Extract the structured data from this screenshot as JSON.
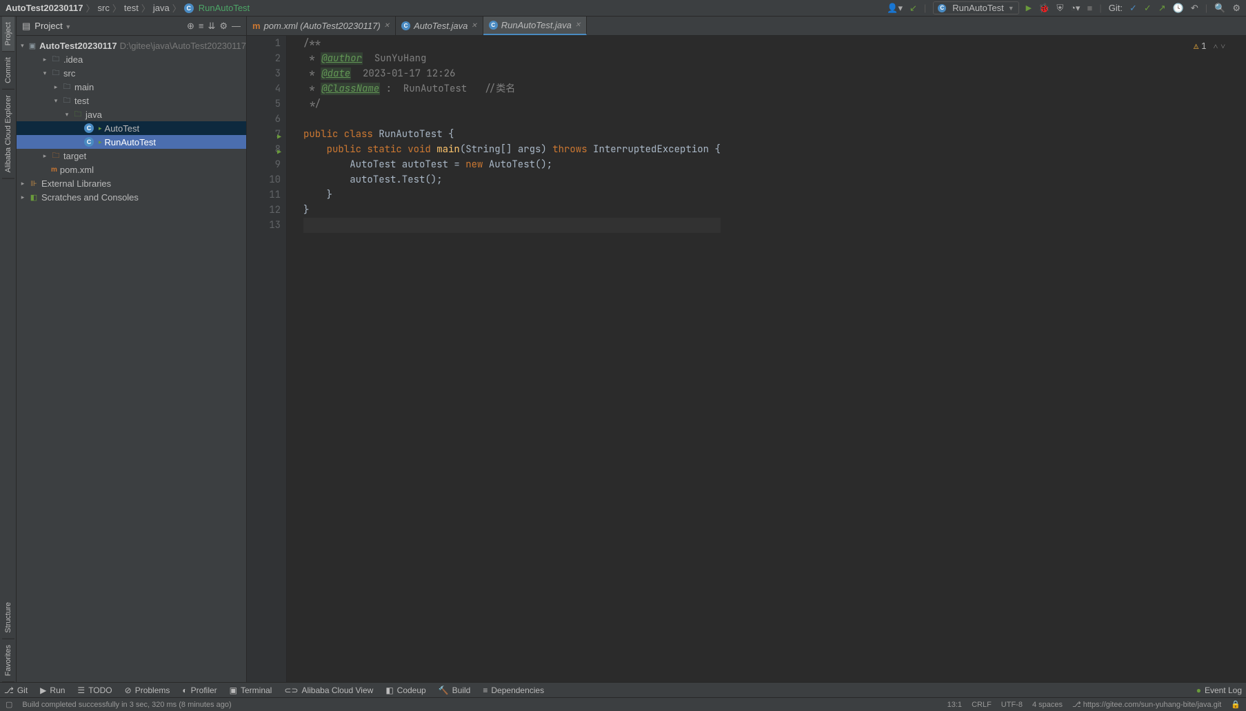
{
  "breadcrumb": [
    "AutoTest20230117",
    "src",
    "test",
    "java",
    "RunAutoTest"
  ],
  "run_config": "RunAutoTest",
  "git_label": "Git:",
  "project": {
    "panel_title": "Project",
    "root": {
      "name": "AutoTest20230117",
      "path": "D:\\gitee\\java\\AutoTest20230117"
    },
    "tree": [
      {
        "name": ".idea",
        "type": "folder",
        "depth": 1,
        "exp": false
      },
      {
        "name": "src",
        "type": "src",
        "depth": 1,
        "exp": true
      },
      {
        "name": "main",
        "type": "folder",
        "depth": 2,
        "exp": false
      },
      {
        "name": "test",
        "type": "folder",
        "depth": 2,
        "exp": true
      },
      {
        "name": "java",
        "type": "test",
        "depth": 3,
        "exp": true
      },
      {
        "name": "AutoTest",
        "type": "class",
        "depth": 4,
        "hl": true
      },
      {
        "name": "RunAutoTest",
        "type": "class-run",
        "depth": 4,
        "sel": true
      },
      {
        "name": "target",
        "type": "target",
        "depth": 1,
        "exp": false
      },
      {
        "name": "pom.xml",
        "type": "pom",
        "depth": 1
      }
    ],
    "ext_libs": "External Libraries",
    "scratches": "Scratches and Consoles"
  },
  "tabs": [
    {
      "label": "pom.xml (AutoTest20230117)",
      "type": "pom"
    },
    {
      "label": "AutoTest.java",
      "type": "class"
    },
    {
      "label": "RunAutoTest.java",
      "type": "class",
      "active": true
    }
  ],
  "code": {
    "lines": [
      {
        "n": 1,
        "html": "<span class='c'>/**</span>"
      },
      {
        "n": 2,
        "html": "<span class='c'> * </span><span class='tag tag-box'>@author</span><span class='s'>  SunYuHang</span>"
      },
      {
        "n": 3,
        "html": "<span class='c'> * </span><span class='tag tag-box'>@date</span><span class='s'>  2023-01-17 12:26</span>"
      },
      {
        "n": 4,
        "html": "<span class='c'> * </span><span class='tag tag-box'>@ClassName</span><span class='s'> :  RunAutoTest   //类名</span>"
      },
      {
        "n": 5,
        "html": "<span class='c'> */</span>"
      },
      {
        "n": 6,
        "html": ""
      },
      {
        "n": 7,
        "html": "<span class='k'>public class </span><span class='nm'>RunAutoTest {</span>",
        "run": true
      },
      {
        "n": 8,
        "html": "    <span class='k'>public static void </span><span class='fn'>main</span><span class='nm'>(String[] args) </span><span class='k'>throws </span><span class='nm'>InterruptedException {</span>",
        "run": true
      },
      {
        "n": 9,
        "html": "        <span class='nm'>AutoTest autoTest = </span><span class='k'>new </span><span class='nm'>AutoTest();</span>"
      },
      {
        "n": 10,
        "html": "        <span class='nm'>autoTest.Test();</span>"
      },
      {
        "n": 11,
        "html": "    <span class='nm'>}</span>"
      },
      {
        "n": 12,
        "html": "<span class='nm'>}</span>"
      },
      {
        "n": 13,
        "html": "",
        "cur": true
      }
    ],
    "warn_count": "1"
  },
  "left_gutter": [
    "Project",
    "Commit",
    "Alibaba Cloud Explorer"
  ],
  "right_gutter_extra": [
    "Structure",
    "Favorites"
  ],
  "bottom_tabs": [
    {
      "icon": "⎇",
      "label": "Git"
    },
    {
      "icon": "▶",
      "label": "Run"
    },
    {
      "icon": "☰",
      "label": "TODO"
    },
    {
      "icon": "⊘",
      "label": "Problems"
    },
    {
      "icon": "◐",
      "label": "Profiler"
    },
    {
      "icon": "▣",
      "label": "Terminal"
    },
    {
      "icon": "⊂⊃",
      "label": "Alibaba Cloud View"
    },
    {
      "icon": "◧",
      "label": "Codeup"
    },
    {
      "icon": "🔨",
      "label": "Build"
    },
    {
      "icon": "≡",
      "label": "Dependencies"
    }
  ],
  "event_log": "Event Log",
  "status": {
    "msg": "Build completed successfully in 3 sec, 320 ms (8 minutes ago)",
    "pos": "13:1",
    "le": "CRLF",
    "enc": "UTF-8",
    "ind": "4 spaces",
    "branch": "https://gitee.com/sun-yuhang-bite/java.git"
  }
}
